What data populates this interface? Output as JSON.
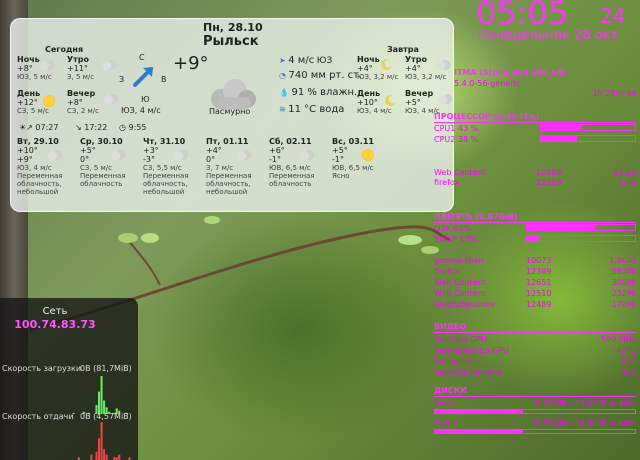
{
  "weather": {
    "header_date": "Пн, 28.10",
    "city": "Рыльск",
    "today_label": "Сегодня",
    "tomorrow_label": "Завтра",
    "now": {
      "temp": "+9°",
      "wind": "ЮЗ, 4 м/с",
      "desc": "Пасмурно",
      "compass": {
        "n": "С",
        "s": "Ю",
        "w": "З",
        "e": "В"
      }
    },
    "today": [
      {
        "label": "Ночь",
        "temp": "+8°",
        "wind": "ЮЗ, 5 м/с",
        "icon": "cloud-icon"
      },
      {
        "label": "Утро",
        "temp": "+11°",
        "wind": "З, 5 м/с",
        "icon": "cloud-icon"
      },
      {
        "label": "День",
        "temp": "+12°",
        "wind": "СЗ, 5 м/с",
        "icon": "sun-icon"
      },
      {
        "label": "Вечер",
        "temp": "+8°",
        "wind": "СЗ, 2 м/с",
        "icon": "cloud-icon"
      }
    ],
    "tomorrow": [
      {
        "label": "Ночь",
        "temp": "+4°",
        "wind": "ЮЗ, 3,2 м/с",
        "icon": "moon-icon"
      },
      {
        "label": "Утро",
        "temp": "+4°",
        "wind": "ЮЗ, 3,2 м/с",
        "icon": "cloud-icon"
      },
      {
        "label": "День",
        "temp": "+10°",
        "wind": "ЮЗ, 4 м/с",
        "icon": "moon-icon"
      },
      {
        "label": "Вечер",
        "temp": "+5°",
        "wind": "ЮЗ, 4 м/с",
        "icon": "cloud-icon"
      }
    ],
    "details": {
      "wind": "4 м/с",
      "wind_dir": "ЮЗ",
      "pressure": "740 мм рт. ст.",
      "humidity": "91 % влажн.",
      "water": "11 °С вода"
    },
    "sunrise": "07:27",
    "sunset": "17:22",
    "daylength": "9:55",
    "forecast": [
      {
        "day": "Вт, 29.10",
        "hi": "+10°",
        "lo": "+9°",
        "wind": "ЮЗ, 4 м/с",
        "desc1": "Переменная",
        "desc2": "облачность,",
        "desc3": "небольшой",
        "icon": "rain-icon"
      },
      {
        "day": "Ср, 30.10",
        "hi": "+5°",
        "lo": "0°",
        "wind": "СЗ, 5 м/с",
        "desc1": "Переменная",
        "desc2": "облачность",
        "desc3": "",
        "icon": "partly-cloudy-icon"
      },
      {
        "day": "Чт, 31.10",
        "hi": "+3°",
        "lo": "-3°",
        "wind": "СЗ, 5,5 м/с",
        "desc1": "Переменная",
        "desc2": "облачность,",
        "desc3": "небольшой",
        "icon": "partly-cloudy-icon"
      },
      {
        "day": "Пт, 01.11",
        "hi": "+4°",
        "lo": "0°",
        "wind": "З, 7 м/с",
        "desc1": "Переменная",
        "desc2": "облачность,",
        "desc3": "небольшой",
        "icon": "rain-icon"
      },
      {
        "day": "Сб, 02.11",
        "hi": "+6°",
        "lo": "-1°",
        "wind": "ЮВ, 6,5 м/с",
        "desc1": "Переменная",
        "desc2": "облачность",
        "desc3": "",
        "icon": "partly-cloudy-icon"
      },
      {
        "day": "Вс, 03.11",
        "hi": "+5°",
        "lo": "-1°",
        "wind": "ЮВ, 6,5 м/с",
        "desc1": "Ясно",
        "desc2": "",
        "desc3": "",
        "icon": "sun-icon"
      }
    ]
  },
  "clock": {
    "time": "05:05",
    "seconds": "24",
    "date": "Понедельник 28 окт"
  },
  "system": {
    "os": "ITMA (S[pre_alc] x86_64)",
    "kernel": "5.4.0-56-generic",
    "uptime": "1h 28m 44",
    "cpu_head": "ПРОЦЕССОР (2,40 ГГц)",
    "cpu1_label": "CPU1 43 %",
    "cpu1_pct": 43,
    "cpu2_label": "CPU2 38 %",
    "cpu2_pct": 38,
    "proc_rows": [
      {
        "name": "Web Content",
        "pid": "12889",
        "val": "22,58"
      },
      {
        "name": "firefox",
        "pid": "12389",
        "val": "1,56"
      }
    ],
    "mem_head": "ПАМЯТЬ (2,07GiB)",
    "ram_label": "ОЗУ 63%",
    "ram_pct": 63,
    "swap_label": "SWAP 12%",
    "swap_pct": 12,
    "mem_rows": [
      {
        "name": "gnome-shell",
        "pid": "10073",
        "val": "1,9GiB"
      },
      {
        "name": "firefox",
        "pid": "12389",
        "val": "583Mi"
      },
      {
        "name": "Web Content",
        "pid": "12651",
        "val": "300Mi"
      },
      {
        "name": "Web Content",
        "pid": "12510",
        "val": "232Mi"
      },
      {
        "name": "WebExtensions",
        "pid": "12489",
        "val": "170Mi"
      }
    ],
    "video_head": "ВИДЕО",
    "video_rows": [
      {
        "name": "Частота GPU",
        "val": "599 MHz"
      },
      {
        "name": "Температура GPU",
        "val": "42°C"
      },
      {
        "name": "Загрузка",
        "val": "0 %"
      },
      {
        "name": "Частота памяти",
        "val": "405"
      }
    ],
    "disk_head": "ДИСКИ",
    "disks": [
      {
        "name": "Root",
        "usage": "8,25GiB / 18,6GiB = 44%",
        "pct": 44
      },
      {
        "name": "Home",
        "usage": "8,25GiB / 18,6GiB = 44%",
        "pct": 44
      }
    ]
  },
  "network": {
    "title": "Сеть",
    "ip": "100.74.83.73",
    "download_label": "Скорость загрузки",
    "download_now": "0B",
    "download_total": "(81,7MiB)",
    "upload_label": "Скорость отдачи",
    "upload_now": "0B",
    "upload_total": "(4,57MiB)",
    "download_history": [
      0,
      0,
      0,
      0,
      0,
      1,
      0,
      0,
      0,
      2,
      0,
      1,
      0,
      0,
      8,
      20,
      34,
      12,
      6,
      2,
      0,
      1,
      5,
      3,
      0,
      0,
      1,
      0,
      0,
      0
    ],
    "upload_history": [
      0,
      0,
      0,
      0,
      0,
      0,
      0,
      1,
      0,
      0,
      0,
      0,
      2,
      0,
      3,
      8,
      14,
      4,
      2,
      0,
      0,
      1,
      1,
      2,
      0,
      0,
      0,
      1,
      0,
      0
    ]
  },
  "colors": {
    "accent": "#ff33ff",
    "download": "#66ee66",
    "upload": "#ee4444"
  }
}
